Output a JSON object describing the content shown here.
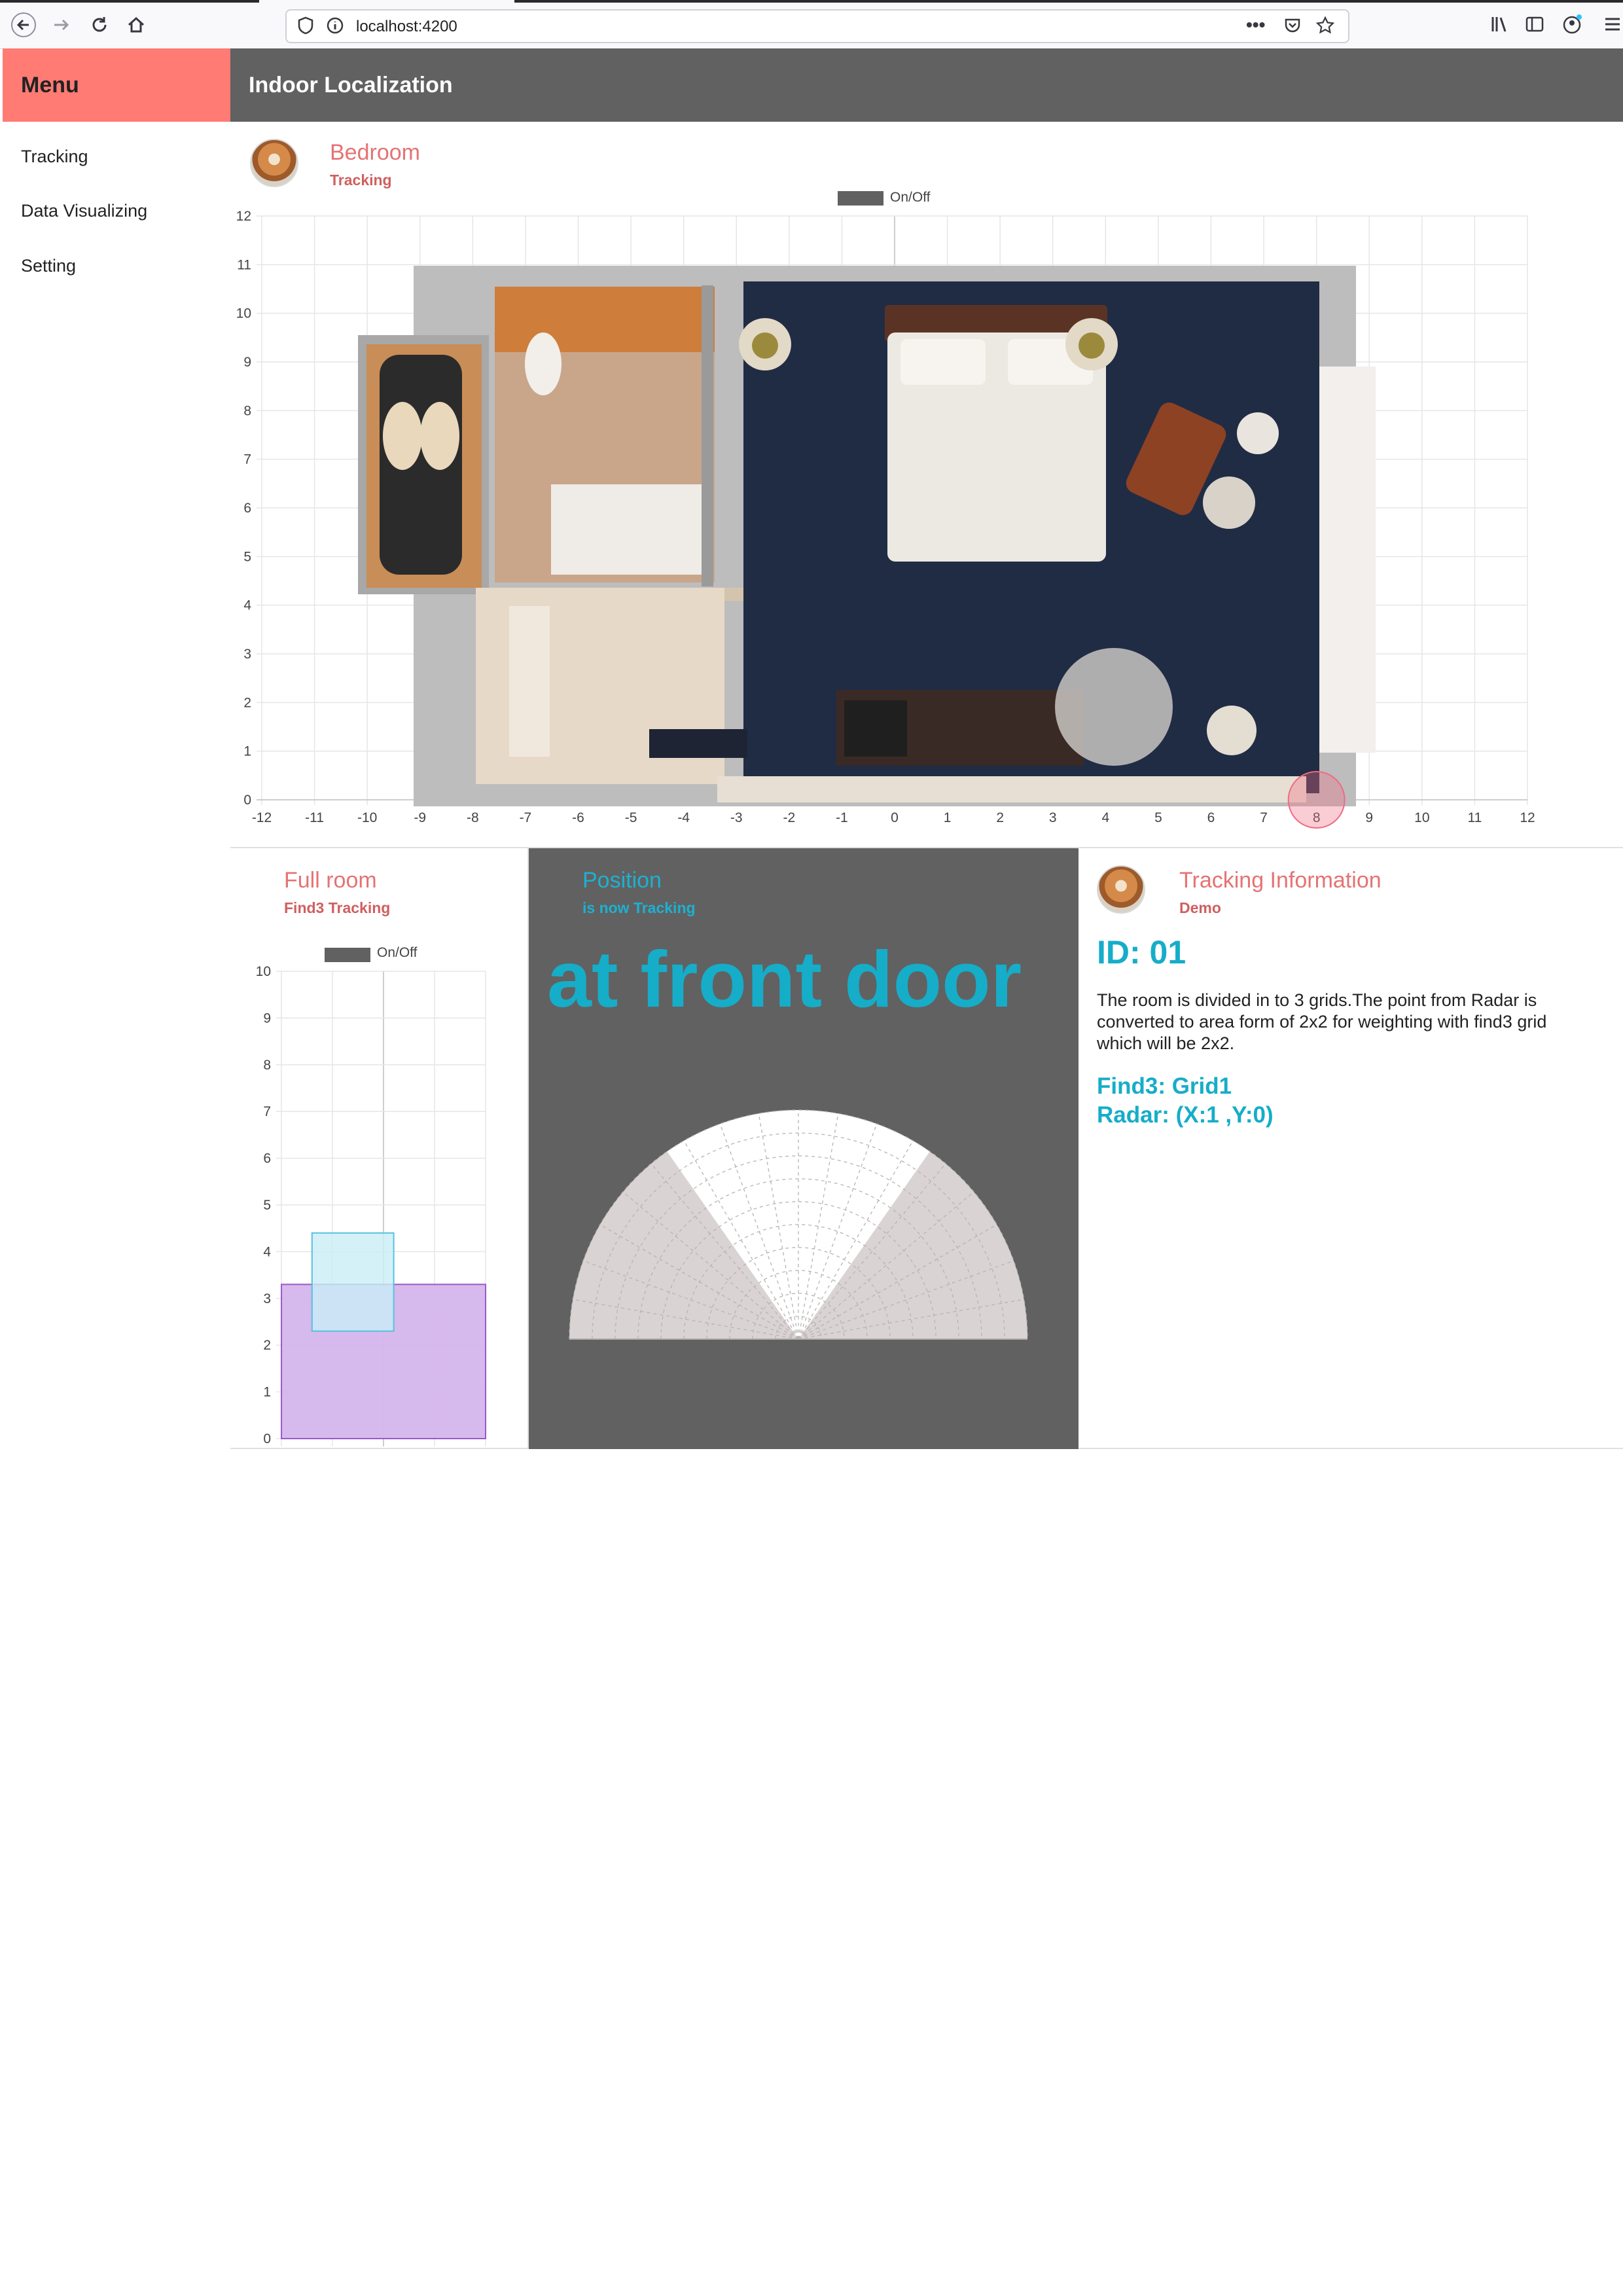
{
  "browser": {
    "url": "localhost:4200"
  },
  "sidebar": {
    "title": "Menu",
    "items": [
      {
        "label": "Tracking"
      },
      {
        "label": "Data Visualizing"
      },
      {
        "label": "Setting"
      }
    ]
  },
  "header": {
    "title": "Indoor Localization"
  },
  "bedroom_card": {
    "title": "Bedroom",
    "subtitle": "Tracking",
    "legend_label": "On/Off",
    "x_ticks": [
      "-12",
      "-11",
      "-10",
      "-9",
      "-8",
      "-7",
      "-6",
      "-5",
      "-4",
      "-3",
      "-2",
      "-1",
      "0",
      "1",
      "2",
      "3",
      "4",
      "5",
      "6",
      "7",
      "8",
      "9",
      "10",
      "11",
      "12"
    ],
    "y_ticks": [
      "0",
      "1",
      "2",
      "3",
      "4",
      "5",
      "6",
      "7",
      "8",
      "9",
      "10",
      "11",
      "12"
    ],
    "tracked_point": {
      "x": 8,
      "y": 0
    }
  },
  "fullroom_card": {
    "title": "Full room",
    "subtitle": "Find3 Tracking",
    "legend_label": "On/Off",
    "y_ticks": [
      "0",
      "1",
      "2",
      "3",
      "4",
      "5",
      "6",
      "7",
      "8",
      "9",
      "10"
    ]
  },
  "position_card": {
    "title": "Position",
    "subtitle": "is now Tracking",
    "location_text": "at front door"
  },
  "tracking_card": {
    "title": "Tracking Information",
    "subtitle": "Demo",
    "id_text": "ID: 01",
    "description": "The room is divided in to 3 grids.The point from Radar is converted to area form of 2x2 for weighting with find3 grid which will be 2x2.",
    "find3_text": "Find3: Grid1",
    "radar_text": "Radar: (X:1 ,Y:0)"
  },
  "colors": {
    "menu_accent": "#ff7b74",
    "header_bg": "#616161",
    "title_red": "#e57373",
    "teal": "#1cb1d1"
  },
  "chart_data": [
    {
      "type": "scatter",
      "x_range": [
        -12,
        12
      ],
      "y_range": [
        0,
        12
      ],
      "grid": true,
      "legend": "top-center",
      "legend_entries": [
        "On/Off"
      ],
      "x": [
        8
      ],
      "y": [
        0
      ]
    },
    {
      "type": "area",
      "y_range": [
        0,
        10
      ],
      "grid": true,
      "legend": "top-center",
      "legend_entries": [
        "On/Off"
      ],
      "series": [
        {
          "x_range": [
            0,
            1
          ],
          "y_range": [
            0,
            3.3
          ],
          "color": "#d4b5ec"
        },
        {
          "x_range": [
            0.15,
            0.55
          ],
          "y_range": [
            2.3,
            4.4
          ],
          "color": "#c9eef6"
        }
      ]
    }
  ]
}
